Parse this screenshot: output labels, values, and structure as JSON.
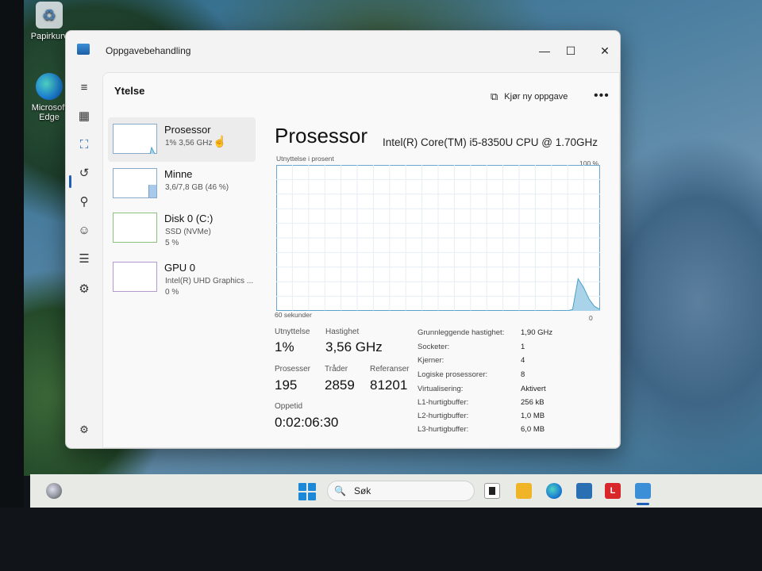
{
  "desktop": {
    "icons": [
      {
        "label": "Papirkurv",
        "icon": "recycle-bin-icon"
      },
      {
        "label": "Microsoft Edge",
        "label_line1": "Microsoft",
        "label_line2": "Edge",
        "icon": "edge-icon"
      }
    ]
  },
  "window": {
    "title": "Oppgavebehandling",
    "controls": {
      "minimize": "—",
      "maximize": "☐",
      "close": "✕"
    }
  },
  "nav": {
    "items": [
      {
        "name": "hamburger-menu-icon",
        "glyph": "≡"
      },
      {
        "name": "processes-icon",
        "glyph": "▦"
      },
      {
        "name": "performance-icon",
        "glyph": "⛶"
      },
      {
        "name": "app-history-icon",
        "glyph": "↺"
      },
      {
        "name": "startup-apps-icon",
        "glyph": "⚲"
      },
      {
        "name": "users-icon",
        "glyph": "☺"
      },
      {
        "name": "details-icon",
        "glyph": "☰"
      },
      {
        "name": "services-icon",
        "glyph": "⚙"
      },
      {
        "name": "settings-icon",
        "glyph": "⚙"
      }
    ]
  },
  "header": {
    "page_title": "Ytelse",
    "run_task": "Kjør ny oppgave",
    "more": "•••"
  },
  "resources": [
    {
      "name": "Prosessor",
      "sub1": "1% 3,56 GHz",
      "sub2": ""
    },
    {
      "name": "Minne",
      "sub1": "3,6/7,8 GB (46 %)",
      "sub2": ""
    },
    {
      "name": "Disk 0 (C:)",
      "sub1": "SSD (NVMe)",
      "sub2": "5 %"
    },
    {
      "name": "GPU 0",
      "sub1": "Intel(R) UHD Graphics ...",
      "sub2": "0 %"
    }
  ],
  "processor": {
    "title": "Prosessor",
    "model": "Intel(R) Core(TM) i5-8350U CPU @ 1.70GHz",
    "chart_label": "Utnyttelse i prosent",
    "chart_max": "100 %",
    "chart_min": "0",
    "chart_xlabel": "60 sekunder",
    "stats": {
      "utilization_label": "Utnyttelse",
      "utilization_value": "1%",
      "speed_label": "Hastighet",
      "speed_value": "3,56 GHz",
      "processes_label": "Prosesser",
      "processes_value": "195",
      "threads_label": "Tråder",
      "threads_value": "2859",
      "handles_label": "Referanser",
      "handles_value": "81201",
      "uptime_label": "Oppetid",
      "uptime_value": "0:02:06:30"
    },
    "specs": [
      {
        "label": "Grunnleggende hastighet:",
        "value": "1,90 GHz"
      },
      {
        "label": "Socketer:",
        "value": "1"
      },
      {
        "label": "Kjerner:",
        "value": "4"
      },
      {
        "label": "Logiske prosessorer:",
        "value": "8"
      },
      {
        "label": "Virtualisering:",
        "value": "Aktivert"
      },
      {
        "label": "L1-hurtigbuffer:",
        "value": "256 kB"
      },
      {
        "label": "L2-hurtigbuffer:",
        "value": "1,0 MB"
      },
      {
        "label": "L3-hurtigbuffer:",
        "value": "6,0 MB"
      }
    ],
    "utilization_history": [
      0,
      0,
      0,
      0,
      0,
      0,
      0,
      0,
      0,
      0,
      0,
      0,
      0,
      0,
      0,
      0,
      0,
      0,
      0,
      0,
      0,
      0,
      0,
      0,
      0,
      0,
      0,
      0,
      0,
      0,
      0,
      0,
      0,
      0,
      0,
      0,
      0,
      0,
      0,
      0,
      0,
      0,
      0,
      0,
      0,
      0,
      0,
      0,
      0,
      0,
      0,
      0,
      0,
      0,
      1,
      22,
      16,
      8,
      3,
      1
    ]
  },
  "taskbar": {
    "search_placeholder": "Søk",
    "apps": [
      {
        "name": "terminal-app-icon",
        "glyph": "■",
        "color": "#222222"
      },
      {
        "name": "file-explorer-app-icon",
        "glyph": "",
        "color": "#f0b429"
      },
      {
        "name": "edge-app-icon",
        "glyph": "e",
        "color": "#1c8fd3"
      },
      {
        "name": "store-app-icon",
        "glyph": "▦",
        "color": "#2b6fb3"
      },
      {
        "name": "l-app-icon",
        "glyph": "L",
        "color": "#d9262b"
      },
      {
        "name": "task-manager-app-icon",
        "glyph": "",
        "color": "#3a8fd6"
      }
    ]
  },
  "colors": {
    "accent": "#1b5fb8",
    "chart_line": "#4a9fc8",
    "chart_fill": "#a9d3e8"
  }
}
